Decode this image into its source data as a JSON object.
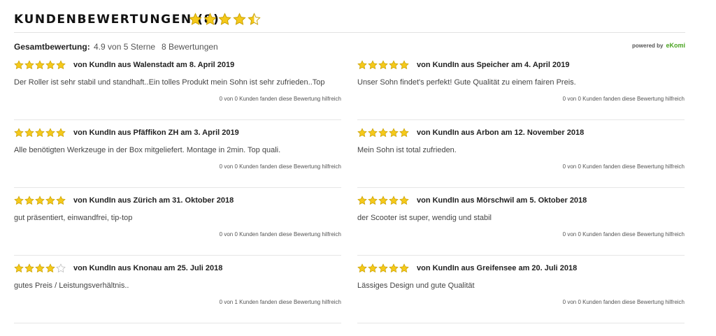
{
  "header": {
    "title": "KUNDENBEWERTUNGEN (8)",
    "rating": 4.5
  },
  "summary": {
    "label": "Gesamtbewertung:",
    "rating_text": "4.9 von 5 Sterne",
    "count_text": "8 Bewertungen",
    "powered_by": "powered by",
    "brand": "eKomi"
  },
  "colors": {
    "star": "#f5c91b",
    "star_empty": "#dddddd",
    "brand": "#49a320"
  },
  "reviews": [
    {
      "rating": 5,
      "author": "von KundIn aus Walenstadt am 8. April 2019",
      "text": "Der Roller ist sehr stabil und standhaft..Ein tolles Produkt mein Sohn ist sehr zufrieden..Top",
      "helpful": "0 von 0 Kunden fanden diese Bewertung hilfreich"
    },
    {
      "rating": 5,
      "author": "von KundIn aus Speicher am 4. April 2019",
      "text": "Unser Sohn findet's perfekt! Gute Qualität zu einem fairen Preis.",
      "helpful": "0 von 0 Kunden fanden diese Bewertung hilfreich"
    },
    {
      "rating": 5,
      "author": "von KundIn aus Pfäffikon ZH am 3. April 2019",
      "text": "Alle benötigten Werkzeuge in der Box mitgeliefert. Montage in 2min. Top quali.",
      "helpful": "0 von 0 Kunden fanden diese Bewertung hilfreich"
    },
    {
      "rating": 5,
      "author": "von KundIn aus Arbon am 12. November 2018",
      "text": "Mein Sohn ist total zufrieden.",
      "helpful": "0 von 0 Kunden fanden diese Bewertung hilfreich"
    },
    {
      "rating": 5,
      "author": "von KundIn aus Zürich am 31. Oktober 2018",
      "text": "gut präsentiert, einwandfrei, tip-top",
      "helpful": "0 von 0 Kunden fanden diese Bewertung hilfreich"
    },
    {
      "rating": 5,
      "author": "von KundIn aus Mörschwil am 5. Oktober 2018",
      "text": "der Scooter ist super, wendig und stabil",
      "helpful": "0 von 0 Kunden fanden diese Bewertung hilfreich"
    },
    {
      "rating": 4,
      "author": "von KundIn aus Knonau am 25. Juli 2018",
      "text": "gutes Preis / Leistungsverhältnis..",
      "helpful": "0 von 1 Kunden fanden diese Bewertung hilfreich"
    },
    {
      "rating": 5,
      "author": "von KundIn aus Greifensee am 20. Juli 2018",
      "text": "Lässiges Design und gute Qualität",
      "helpful": "0 von 0 Kunden fanden diese Bewertung hilfreich"
    }
  ]
}
